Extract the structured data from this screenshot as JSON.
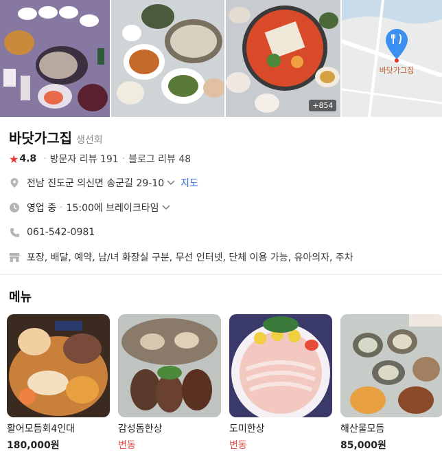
{
  "photos": {
    "more_count": "+854",
    "map_label": "바닷가그집"
  },
  "place": {
    "name": "바닷가그집",
    "category": "생선회",
    "rating": "4.8",
    "visitor_reviews": "방문자 리뷰 191",
    "blog_reviews": "블로그 리뷰 48",
    "address": "전남 진도군 의신면 송군길 29-10",
    "map_link": "지도",
    "hours_status": "영업 중",
    "hours_break": "15:00에 브레이크타임",
    "phone": "061-542-0981",
    "facilities": "포장, 배달, 예약, 남/녀 화장실 구분, 무선 인터넷, 단체 이용 가능, 유아의자, 주차"
  },
  "menu": {
    "title": "메뉴",
    "items": [
      {
        "name": "활어모듬회4인대",
        "price": "180,000원"
      },
      {
        "name": "감성돔한상",
        "price": "변동"
      },
      {
        "name": "도미한상",
        "price": "변동"
      },
      {
        "name": "해산물모듬",
        "price": "85,000원"
      }
    ]
  },
  "colors": {
    "star": "#e8352f",
    "link": "#2d6de0",
    "variable_price": "#e8514a",
    "map_pin": "#3b8ff0"
  },
  "icons": [
    "star-icon",
    "location-pin-icon",
    "clock-icon",
    "phone-icon",
    "store-icon",
    "chevron-down-icon",
    "map-pin-icon"
  ]
}
